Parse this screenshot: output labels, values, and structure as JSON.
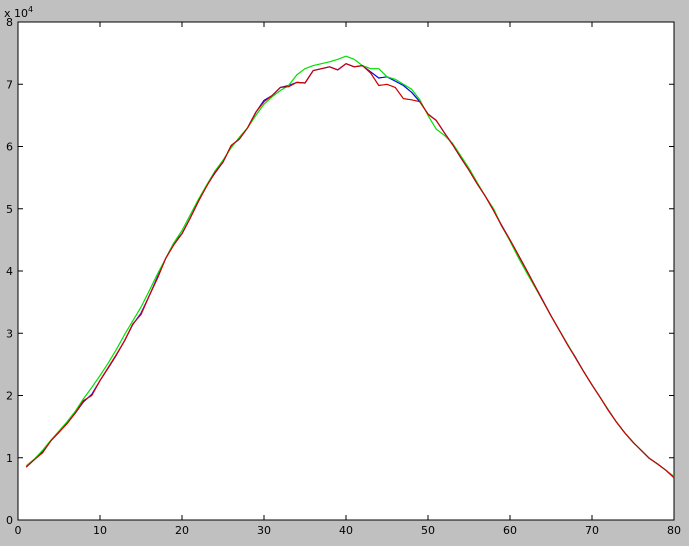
{
  "chart_data": {
    "type": "line",
    "title": "",
    "xlabel": "",
    "ylabel": "",
    "xlim": [
      0,
      80
    ],
    "ylim": [
      0,
      8
    ],
    "y_exponent_label": "x 10",
    "y_exponent_power": "4",
    "xticks": [
      0,
      10,
      20,
      30,
      40,
      50,
      60,
      70,
      80
    ],
    "yticks": [
      0,
      1,
      2,
      3,
      4,
      5,
      6,
      7,
      8
    ],
    "grid": false,
    "legend": "none",
    "series": [
      {
        "color": "#0000ff",
        "x": [
          1,
          2,
          3,
          4,
          5,
          6,
          7,
          8,
          9,
          10,
          11,
          12,
          13,
          14,
          15,
          16,
          17,
          18,
          19,
          20,
          21,
          22,
          23,
          24,
          25,
          26,
          27,
          28,
          29,
          30,
          31,
          32,
          33,
          34,
          35,
          36,
          37,
          38,
          39,
          40,
          41,
          42,
          43,
          44,
          45,
          46,
          47,
          48,
          49,
          50,
          51,
          52,
          53,
          54,
          55,
          56,
          57,
          58,
          59,
          60,
          61,
          62,
          63,
          64,
          65,
          66,
          67,
          68,
          69,
          70,
          71,
          72,
          73,
          74,
          75,
          76,
          77,
          78,
          79,
          80
        ],
        "y": [
          0.85,
          0.97,
          1.1,
          1.27,
          1.41,
          1.56,
          1.72,
          1.9,
          2.02,
          2.24,
          2.44,
          2.65,
          2.88,
          3.14,
          3.32,
          3.6,
          3.9,
          4.2,
          4.45,
          4.6,
          4.85,
          5.12,
          5.37,
          5.57,
          5.75,
          6.01,
          6.12,
          6.3,
          6.55,
          6.74,
          6.82,
          6.95,
          6.98,
          7.03,
          7.02,
          7.22,
          7.25,
          7.28,
          7.23,
          7.33,
          7.28,
          7.3,
          7.2,
          7.1,
          7.12,
          7.05,
          6.98,
          6.87,
          6.72,
          6.52,
          6.42,
          6.22,
          6.03,
          5.82,
          5.62,
          5.4,
          5.2,
          4.97,
          4.73,
          4.5,
          4.26,
          4.02,
          3.77,
          3.53,
          3.28,
          3.05,
          2.82,
          2.61,
          2.38,
          2.17,
          1.97,
          1.76,
          1.57,
          1.4,
          1.25,
          1.12,
          0.99,
          0.9,
          0.8,
          0.68
        ]
      },
      {
        "color": "#00e000",
        "x": [
          1,
          2,
          3,
          4,
          5,
          6,
          7,
          8,
          9,
          10,
          11,
          12,
          13,
          14,
          15,
          16,
          17,
          18,
          19,
          20,
          21,
          22,
          23,
          24,
          25,
          26,
          27,
          28,
          29,
          30,
          31,
          32,
          33,
          34,
          35,
          36,
          37,
          38,
          39,
          40,
          41,
          42,
          43,
          44,
          45,
          46,
          47,
          48,
          49,
          50,
          51,
          52,
          53,
          54,
          55,
          56,
          57,
          58,
          59,
          60,
          61,
          62,
          63,
          64,
          65,
          66,
          67,
          68,
          69,
          70,
          71,
          72,
          73,
          74,
          75,
          76,
          77,
          78,
          79,
          80
        ],
        "y": [
          0.87,
          0.98,
          1.12,
          1.28,
          1.43,
          1.58,
          1.75,
          1.95,
          2.13,
          2.32,
          2.52,
          2.74,
          2.98,
          3.2,
          3.42,
          3.68,
          3.95,
          4.2,
          4.45,
          4.65,
          4.9,
          5.15,
          5.38,
          5.6,
          5.78,
          5.98,
          6.15,
          6.3,
          6.5,
          6.68,
          6.8,
          6.9,
          6.98,
          7.15,
          7.25,
          7.3,
          7.33,
          7.36,
          7.4,
          7.45,
          7.4,
          7.3,
          7.25,
          7.25,
          7.12,
          7.08,
          7.0,
          6.92,
          6.75,
          6.5,
          6.28,
          6.18,
          6.05,
          5.85,
          5.65,
          5.42,
          5.2,
          5.0,
          4.72,
          4.48,
          4.22,
          3.98,
          3.75,
          3.52,
          3.28,
          3.05,
          2.83,
          2.6,
          2.38,
          2.17,
          1.97,
          1.77,
          1.57,
          1.4,
          1.25,
          1.12,
          0.99,
          0.9,
          0.8,
          0.7
        ]
      },
      {
        "color": "#d00000",
        "x": [
          1,
          2,
          3,
          4,
          5,
          6,
          7,
          8,
          9,
          10,
          11,
          12,
          13,
          14,
          15,
          16,
          17,
          18,
          19,
          20,
          21,
          22,
          23,
          24,
          25,
          26,
          27,
          28,
          29,
          30,
          31,
          32,
          33,
          34,
          35,
          36,
          37,
          38,
          39,
          40,
          41,
          42,
          43,
          44,
          45,
          46,
          47,
          48,
          49,
          50,
          51,
          52,
          53,
          54,
          55,
          56,
          57,
          58,
          59,
          60,
          61,
          62,
          63,
          64,
          65,
          66,
          67,
          68,
          69,
          70,
          71,
          72,
          73,
          74,
          75,
          76,
          77,
          78,
          79,
          80
        ],
        "y": [
          0.85,
          0.97,
          1.08,
          1.27,
          1.41,
          1.55,
          1.72,
          1.92,
          2.0,
          2.24,
          2.45,
          2.66,
          2.88,
          3.15,
          3.3,
          3.6,
          3.88,
          4.2,
          4.42,
          4.6,
          4.85,
          5.12,
          5.36,
          5.58,
          5.75,
          6.02,
          6.12,
          6.3,
          6.55,
          6.72,
          6.82,
          6.95,
          6.96,
          7.03,
          7.02,
          7.22,
          7.25,
          7.28,
          7.23,
          7.33,
          7.28,
          7.3,
          7.18,
          6.98,
          7.0,
          6.95,
          6.77,
          6.75,
          6.72,
          6.52,
          6.42,
          6.22,
          6.03,
          5.82,
          5.62,
          5.4,
          5.2,
          4.97,
          4.72,
          4.5,
          4.26,
          4.02,
          3.77,
          3.52,
          3.28,
          3.05,
          2.82,
          2.6,
          2.38,
          2.17,
          1.97,
          1.76,
          1.57,
          1.4,
          1.25,
          1.12,
          0.99,
          0.9,
          0.8,
          0.68
        ]
      }
    ]
  }
}
